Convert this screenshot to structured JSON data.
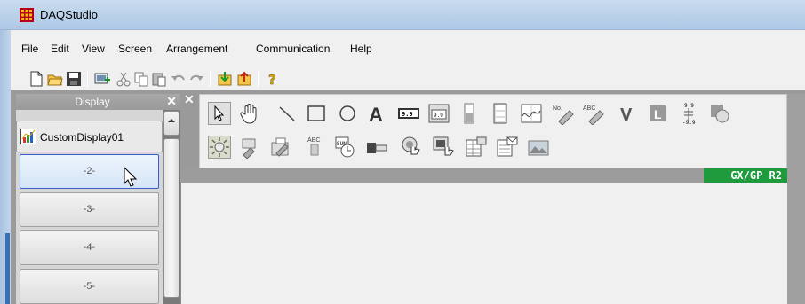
{
  "window": {
    "title": "DAQStudio",
    "app_icon": "grid-icon"
  },
  "menu": [
    "File",
    "Edit",
    "View",
    "Screen",
    "Arrangement",
    "Communication",
    "Help"
  ],
  "toolbar": {
    "icons": [
      "new-file-icon",
      "open-folder-icon",
      "save-icon",
      "add-screen-icon",
      "cut-icon",
      "copy-icon",
      "paste-icon",
      "undo-icon",
      "redo-icon",
      "download-icon",
      "upload-icon",
      "help-icon"
    ]
  },
  "display_panel": {
    "title": "Display",
    "items": [
      {
        "label": "CustomDisplay01",
        "icon": "chart-icon",
        "state": "normal"
      },
      {
        "label": "-2-",
        "state": "selected"
      },
      {
        "label": "-3-",
        "state": "normal"
      },
      {
        "label": "-4-",
        "state": "normal"
      },
      {
        "label": "-5-",
        "state": "normal"
      }
    ]
  },
  "parts_toolbar": {
    "row1": [
      "select-pointer-icon",
      "pan-hand-icon",
      "line-icon",
      "rectangle-icon",
      "circle-icon",
      "text-icon",
      "digital-display-icon",
      "digital-box-icon",
      "bar-graph-icon",
      "multi-digital-icon",
      "trend-graph-icon",
      "tag-number-icon",
      "tag-comment-icon",
      "value-icon",
      "label-icon",
      "scale-icon",
      "bitmap-icon"
    ],
    "row2": [
      "alarm-indicator-icon",
      "alarm-mark-icon",
      "message-icon",
      "abc-tag-icon",
      "clock-icon",
      "switch-icon",
      "push-button-icon",
      "touch-button-icon",
      "table-icon",
      "message-list-icon",
      "image-icon"
    ]
  },
  "status": {
    "model_label": "GX/GP R2",
    "model_color": "#1f9a3c"
  },
  "colors": {
    "panel_gray": "#9a9a9a",
    "selected_border": "#3a5fcd"
  }
}
